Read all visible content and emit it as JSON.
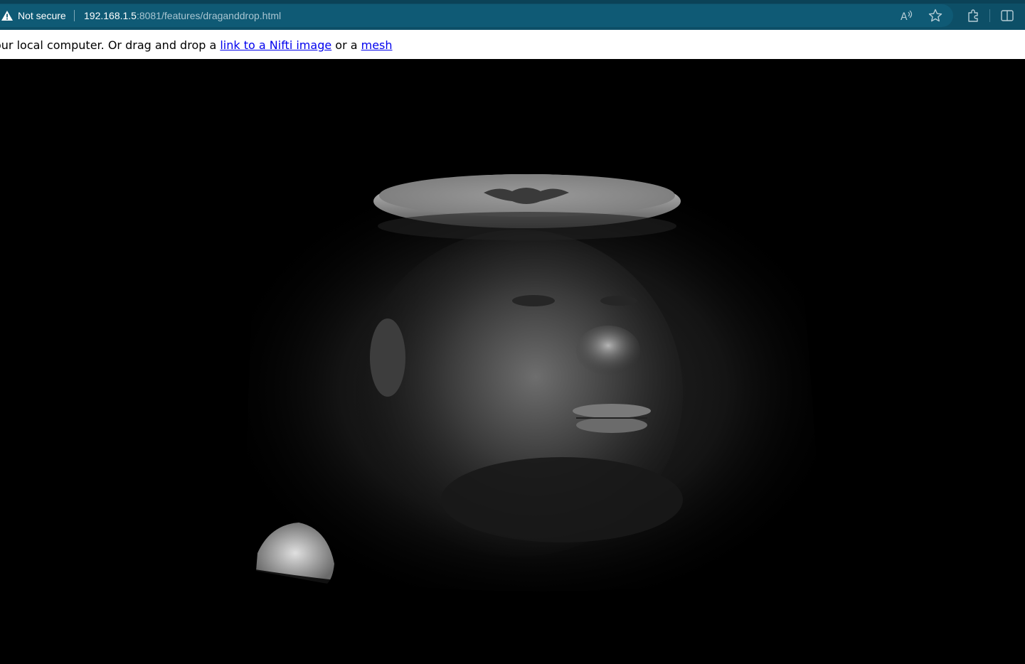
{
  "browser": {
    "security_label": "Not secure",
    "url_host": "192.168.1.5",
    "url_path": ":8081/features/draganddrop.html",
    "icons": [
      "warning-icon",
      "read-aloud-icon",
      "favorite-star-icon",
      "extensions-icon",
      "split-screen-icon"
    ]
  },
  "page": {
    "instruction_prefix": "our local computer. Or drag and drop a ",
    "nifti_link": "link to a Nifti image",
    "instruction_middle": " or a ",
    "mesh_link": "mesh"
  },
  "viewer": {
    "background": "#000000",
    "content": "volume-render"
  },
  "colors": {
    "toolbar": "#0d4f67",
    "addressbar": "#0f5a75",
    "link": "#0000ee"
  }
}
